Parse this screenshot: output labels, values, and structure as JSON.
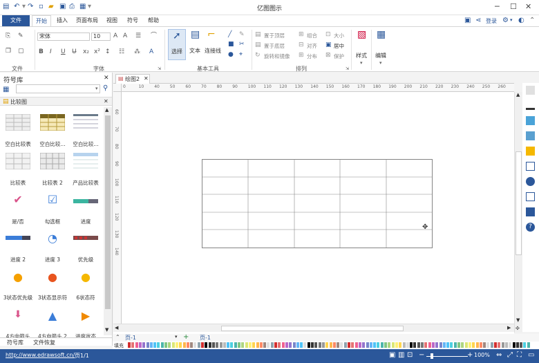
{
  "title": "亿图图示",
  "top_right": {
    "login": "登录"
  },
  "tabs": [
    "文件",
    "开始",
    "插入",
    "页面布局",
    "视图",
    "符号",
    "帮助"
  ],
  "ribbon": {
    "font_name": "宋体",
    "font_size": "10",
    "groups": [
      "文件",
      "字体",
      "基本工具",
      "排列"
    ],
    "tools": [
      "选择",
      "文本",
      "连接线"
    ],
    "arrange": {
      "bring_front": "置于顶层",
      "send_back": "置于底层",
      "rotate": "旋转和镜像",
      "group": "组合",
      "align": "对齐",
      "distribute": "分布",
      "size": "大小",
      "center": "居中",
      "protect": "保护"
    },
    "style": "样式",
    "edit": "编辑"
  },
  "sidebar": {
    "title": "符号库",
    "category": "比较图",
    "items": [
      "空白比较表",
      "空白比较...",
      "空白比较...",
      "比较表",
      "比较表 2",
      "产品比较表",
      "是/否",
      "勾选框",
      "进度",
      "进度 2",
      "进度 3",
      "优先级",
      "3状态优先级",
      "3状态显示符",
      "6状态符",
      "4方向箭头",
      "4方向箭头 2",
      "进度状态"
    ],
    "bottom_tabs": [
      "符号库",
      "文件恢复"
    ]
  },
  "doc_tab": "绘图2",
  "ruler_h": [
    "0",
    "10",
    "40",
    "50",
    "60",
    "70",
    "80",
    "90",
    "100",
    "110",
    "120",
    "130",
    "140",
    "150",
    "160",
    "170",
    "180",
    "190",
    "200",
    "210",
    "220",
    "230",
    "240",
    "250",
    "260"
  ],
  "ruler_v": [
    "60",
    "70",
    "80",
    "90",
    "100",
    "110",
    "120",
    "130",
    "140"
  ],
  "page_tabs": {
    "current": "页-1",
    "tab": "页-1"
  },
  "fill_label": "填充",
  "status": {
    "url": "http://www.edrawsoft.cn/",
    "page": "页1/1",
    "zoom": "100%"
  },
  "colors": {
    "accent": "#2b579a"
  }
}
